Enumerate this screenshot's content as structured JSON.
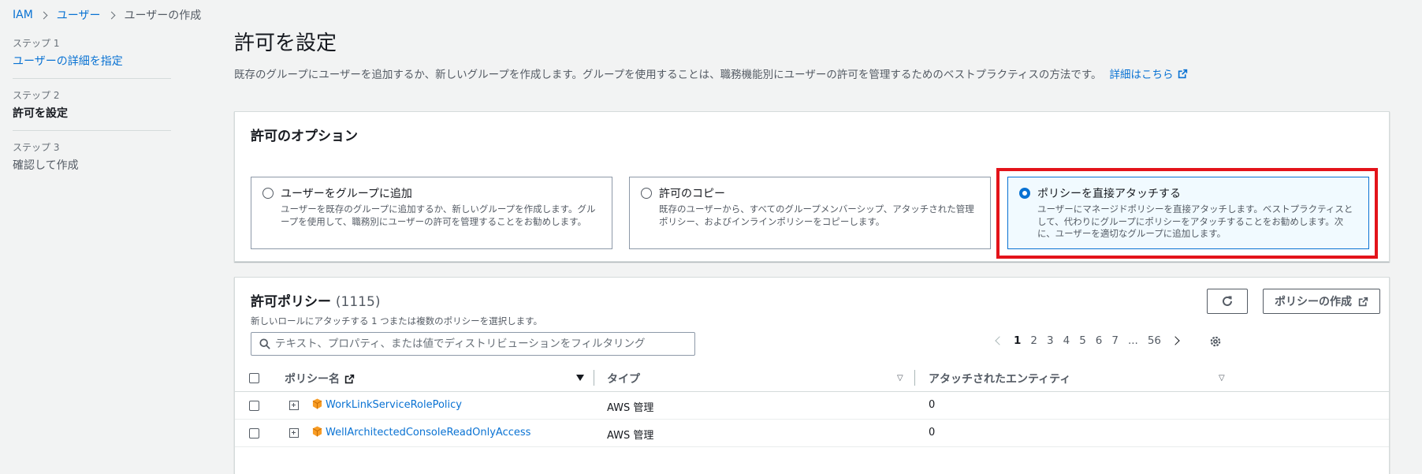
{
  "breadcrumb": {
    "root": "IAM",
    "users": "ユーザー",
    "current": "ユーザーの作成"
  },
  "steps": [
    {
      "num": "ステップ 1",
      "label": "ユーザーの詳細を指定"
    },
    {
      "num": "ステップ 2",
      "label": "許可を設定"
    },
    {
      "num": "ステップ 3",
      "label": "確認して作成"
    }
  ],
  "page": {
    "title": "許可を設定",
    "description": "既存のグループにユーザーを追加するか、新しいグループを作成します。グループを使用することは、職務機能別にユーザーの許可を管理するためのベストプラクティスの方法です。",
    "learn_more": "詳細はこちら"
  },
  "options": {
    "title": "許可のオプション",
    "items": [
      {
        "title": "ユーザーをグループに追加",
        "desc": "ユーザーを既存のグループに追加するか、新しいグループを作成します。グループを使用して、職務別にユーザーの許可を管理することをお勧めします。"
      },
      {
        "title": "許可のコピー",
        "desc": "既存のユーザーから、すべてのグループメンバーシップ、アタッチされた管理ポリシー、およびインラインポリシーをコピーします。"
      },
      {
        "title": "ポリシーを直接アタッチする",
        "desc": "ユーザーにマネージドポリシーを直接アタッチします。ベストプラクティスとして、代わりにグループにポリシーをアタッチすることをお勧めします。次に、ユーザーを適切なグループに追加します。"
      }
    ],
    "selected_index": 2
  },
  "policies": {
    "title": "許可ポリシー",
    "count": "(1115)",
    "description": "新しいロールにアタッチする 1 つまたは複数のポリシーを選択します。",
    "create_button": "ポリシーの作成",
    "filter_placeholder": "テキスト、プロパティ、または値でディストリビューションをフィルタリング",
    "pagination": [
      "1",
      "2",
      "3",
      "4",
      "5",
      "6",
      "7",
      "...",
      "56"
    ],
    "columns": {
      "name": "ポリシー名",
      "type": "タイプ",
      "entities": "アタッチされたエンティティ"
    },
    "rows": [
      {
        "name": "WorkLinkServiceRolePolicy",
        "type": "AWS 管理",
        "entities": "0"
      },
      {
        "name": "WellArchitectedConsoleReadOnlyAccess",
        "type": "AWS 管理",
        "entities": "0"
      }
    ]
  },
  "colors": {
    "link": "#0972d3",
    "highlight": "#e3131a",
    "selected_bg": "#f1faff"
  }
}
